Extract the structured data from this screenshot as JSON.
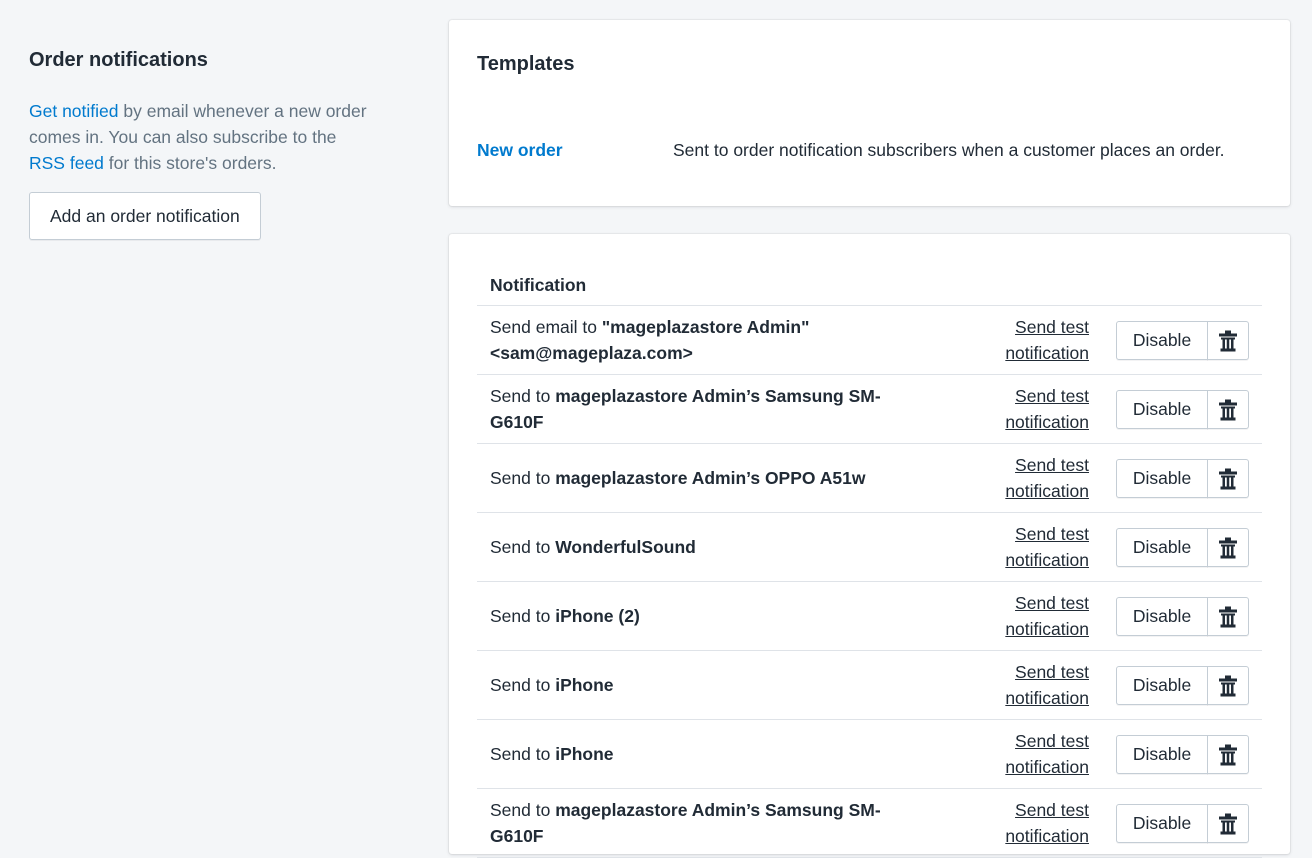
{
  "sidebar": {
    "title": "Order notifications",
    "description": {
      "link1": "Get notified",
      "text1": " by email whenever a new order comes in. You can also subscribe to the ",
      "link2": "RSS feed",
      "text2": " for this store's orders."
    },
    "add_button": "Add an order notification"
  },
  "templates": {
    "title": "Templates",
    "items": [
      {
        "name": "New order",
        "description": "Sent to order notification subscribers when a customer places an order."
      }
    ]
  },
  "notifications": {
    "header": "Notification",
    "send_test_label": "Send test notification",
    "disable_label": "Disable",
    "rows": [
      {
        "prefix": "Send email to ",
        "target": "\"mageplazastore Admin\" <sam@mageplaza.com>"
      },
      {
        "prefix": "Send to ",
        "target": "mageplazastore Admin’s Samsung SM-G610F"
      },
      {
        "prefix": "Send to ",
        "target": "mageplazastore Admin’s OPPO A51w"
      },
      {
        "prefix": "Send to ",
        "target": "WonderfulSound"
      },
      {
        "prefix": "Send to ",
        "target": "iPhone (2)"
      },
      {
        "prefix": "Send to ",
        "target": "iPhone"
      },
      {
        "prefix": "Send to ",
        "target": "iPhone"
      },
      {
        "prefix": "Send to ",
        "target": "mageplazastore Admin’s Samsung SM-G610F"
      }
    ]
  },
  "colors": {
    "link": "#007ace",
    "text": "#212b36",
    "muted": "#637381",
    "background": "#f4f6f8"
  },
  "icons": {
    "delete": "trash-icon"
  }
}
